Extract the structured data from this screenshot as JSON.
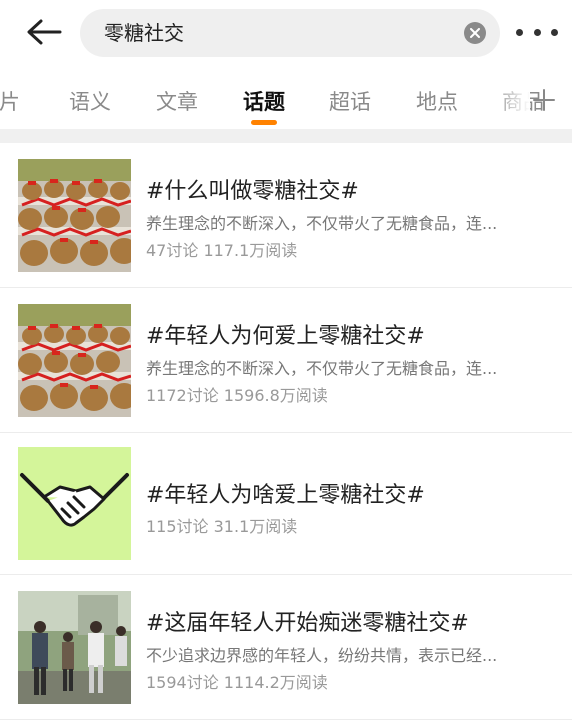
{
  "header": {
    "search_value": "零糖社交",
    "back_icon": "back-arrow-icon",
    "clear_icon": "clear-icon",
    "more_icon": "more-icon"
  },
  "tabs": [
    {
      "label": "图片",
      "active": false
    },
    {
      "label": "语义",
      "active": false
    },
    {
      "label": "文章",
      "active": false
    },
    {
      "label": "话题",
      "active": true
    },
    {
      "label": "超话",
      "active": false
    },
    {
      "label": "地点",
      "active": false
    },
    {
      "label": "商品",
      "active": false
    }
  ],
  "add_tab_icon": "plus-icon",
  "accent_color": "#ff8200",
  "topics": [
    {
      "title": "#什么叫做零糖社交#",
      "desc": "养生理念的不断深入，不仅带火了无糖食品，连...",
      "stats": "47讨论 117.1万阅读",
      "thumb": "capybara-plush-photo"
    },
    {
      "title": "#年轻人为何爱上零糖社交#",
      "desc": "养生理念的不断深入，不仅带火了无糖食品，连...",
      "stats": "1172讨论 1596.8万阅读",
      "thumb": "capybara-plush-photo"
    },
    {
      "title": "#年轻人为啥爱上零糖社交#",
      "desc": "",
      "stats": "115讨论 31.1万阅读",
      "thumb": "handshake-illustration"
    },
    {
      "title": "#这届年轻人开始痴迷零糖社交#",
      "desc": "不少追求边界感的年轻人，纷纷共情，表示已经...",
      "stats": "1594讨论 1114.2万阅读",
      "thumb": "people-walking-photo"
    }
  ]
}
